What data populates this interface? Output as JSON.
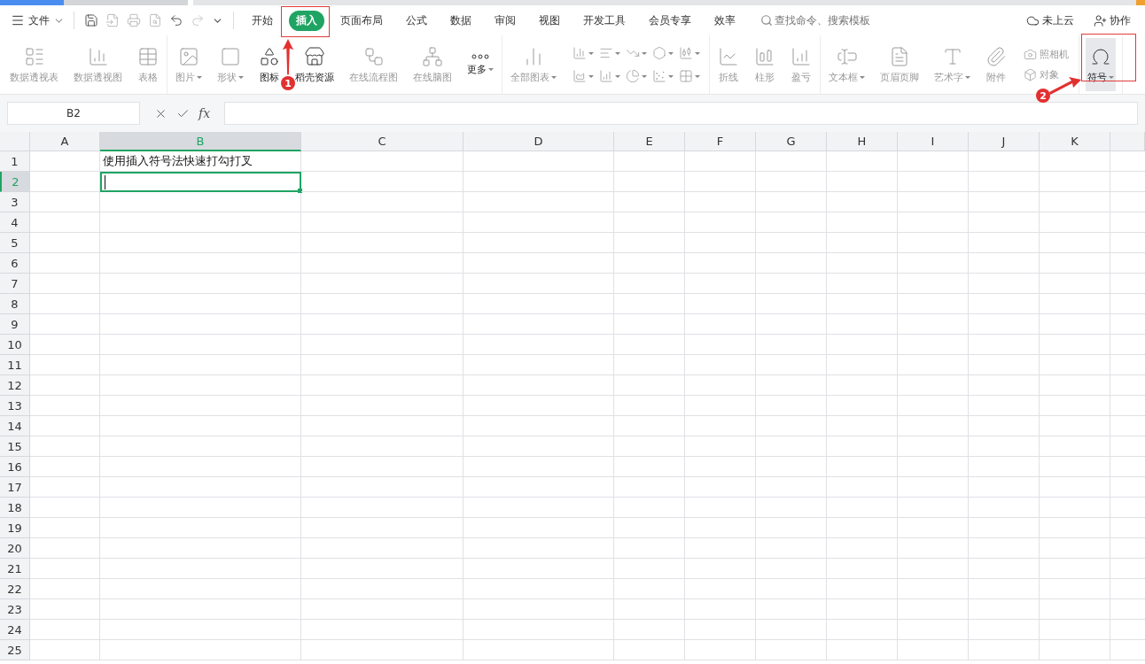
{
  "menu": {
    "file_label": "文件",
    "tabs": [
      {
        "label": "开始",
        "selected": false
      },
      {
        "label": "插入",
        "selected": true
      },
      {
        "label": "页面布局",
        "selected": false
      },
      {
        "label": "公式",
        "selected": false
      },
      {
        "label": "数据",
        "selected": false
      },
      {
        "label": "审阅",
        "selected": false
      },
      {
        "label": "视图",
        "selected": false
      },
      {
        "label": "开发工具",
        "selected": false
      },
      {
        "label": "会员专享",
        "selected": false
      },
      {
        "label": "效率",
        "selected": false
      }
    ],
    "search": {
      "placeholder": "查找命令、搜索模板"
    },
    "cloud": "未上云",
    "collab": "协作"
  },
  "ribbon": {
    "groups": [
      {
        "items": [
          {
            "kind": "large",
            "label": "数据透视表",
            "disabled": true,
            "dropdown": false,
            "highlighted": false
          },
          {
            "kind": "large",
            "label": "数据透视图",
            "disabled": true,
            "dropdown": false,
            "highlighted": false
          },
          {
            "kind": "large",
            "label": "表格",
            "disabled": true,
            "dropdown": false,
            "highlighted": false
          }
        ]
      },
      {
        "items": [
          {
            "kind": "large",
            "label": "图片",
            "disabled": true,
            "dropdown": true,
            "highlighted": false
          },
          {
            "kind": "large",
            "label": "形状",
            "disabled": true,
            "dropdown": true,
            "highlighted": false
          },
          {
            "kind": "large",
            "label": "图标",
            "disabled": false,
            "dropdown": false,
            "highlighted": false
          },
          {
            "kind": "large",
            "label": "稻壳资源",
            "disabled": false,
            "dropdown": false,
            "highlighted": false
          },
          {
            "kind": "large",
            "label": "在线流程图",
            "disabled": true,
            "dropdown": false,
            "highlighted": false
          },
          {
            "kind": "large",
            "label": "在线脑图",
            "disabled": true,
            "dropdown": false,
            "highlighted": false
          },
          {
            "kind": "large",
            "label": "更多",
            "disabled": false,
            "dropdown": true,
            "highlighted": false
          }
        ]
      },
      {
        "items": [
          {
            "kind": "large",
            "label": "全部图表",
            "disabled": true,
            "dropdown": true,
            "highlighted": false
          },
          {
            "kind": "icon",
            "disabled": true,
            "dropdown": true,
            "highlighted": false
          },
          {
            "kind": "icon",
            "disabled": true,
            "dropdown": true,
            "highlighted": false
          },
          {
            "kind": "icon",
            "disabled": true,
            "dropdown": true,
            "highlighted": false
          },
          {
            "kind": "icon",
            "disabled": true,
            "dropdown": true,
            "highlighted": false
          },
          {
            "kind": "icon",
            "disabled": true,
            "dropdown": true,
            "highlighted": false
          },
          {
            "kind": "icon",
            "disabled": true,
            "dropdown": true,
            "highlighted": false
          },
          {
            "kind": "icon",
            "disabled": true,
            "dropdown": true,
            "highlighted": false
          },
          {
            "kind": "icon",
            "disabled": true,
            "dropdown": true,
            "highlighted": false
          },
          {
            "kind": "icon",
            "disabled": true,
            "dropdown": true,
            "highlighted": false
          },
          {
            "kind": "icon",
            "disabled": true,
            "dropdown": true,
            "highlighted": false
          }
        ]
      },
      {
        "items": [
          {
            "kind": "large",
            "label": "折线",
            "disabled": true,
            "dropdown": false,
            "highlighted": false
          },
          {
            "kind": "large",
            "label": "柱形",
            "disabled": true,
            "dropdown": false,
            "highlighted": false
          },
          {
            "kind": "large",
            "label": "盈亏",
            "disabled": true,
            "dropdown": false,
            "highlighted": false
          }
        ]
      },
      {
        "items": [
          {
            "kind": "large",
            "label": "文本框",
            "disabled": true,
            "dropdown": true,
            "highlighted": false
          },
          {
            "kind": "large",
            "label": "页眉页脚",
            "disabled": true,
            "dropdown": false,
            "highlighted": false
          },
          {
            "kind": "large",
            "label": "艺术字",
            "disabled": true,
            "dropdown": true,
            "highlighted": false
          },
          {
            "kind": "large",
            "label": "附件",
            "disabled": true,
            "dropdown": false,
            "highlighted": false
          },
          {
            "kind": "small",
            "label": "照相机",
            "disabled": true,
            "dropdown": false,
            "highlighted": false
          },
          {
            "kind": "small",
            "label": "对象",
            "disabled": true,
            "dropdown": false,
            "highlighted": false
          }
        ]
      },
      {
        "items": [
          {
            "kind": "large",
            "label": "符号",
            "disabled": false,
            "dropdown": true,
            "highlighted": true
          }
        ]
      }
    ]
  },
  "formula_bar": {
    "name_box": "B2",
    "fx": "fx"
  },
  "sheet": {
    "columns": [
      {
        "label": "A",
        "selected": false
      },
      {
        "label": "B",
        "selected": true
      },
      {
        "label": "C",
        "selected": false
      },
      {
        "label": "D",
        "selected": false
      },
      {
        "label": "E",
        "selected": false
      },
      {
        "label": "F",
        "selected": false
      },
      {
        "label": "G",
        "selected": false
      },
      {
        "label": "H",
        "selected": false
      },
      {
        "label": "I",
        "selected": false
      },
      {
        "label": "J",
        "selected": false
      },
      {
        "label": "K",
        "selected": false
      }
    ],
    "rows": [
      {
        "label": "1",
        "selected": false,
        "cells": [
          {},
          {
            "text": "使用插入符号法快速打勾打叉"
          }
        ]
      },
      {
        "label": "2",
        "selected": true
      },
      {
        "label": "3",
        "selected": false
      },
      {
        "label": "4",
        "selected": false
      },
      {
        "label": "5",
        "selected": false
      },
      {
        "label": "6",
        "selected": false
      },
      {
        "label": "7",
        "selected": false
      },
      {
        "label": "8",
        "selected": false
      },
      {
        "label": "9",
        "selected": false
      },
      {
        "label": "10",
        "selected": false
      },
      {
        "label": "11",
        "selected": false
      },
      {
        "label": "12",
        "selected": false
      },
      {
        "label": "13",
        "selected": false
      },
      {
        "label": "14",
        "selected": false
      },
      {
        "label": "15",
        "selected": false
      },
      {
        "label": "16",
        "selected": false
      },
      {
        "label": "17",
        "selected": false
      },
      {
        "label": "18",
        "selected": false
      },
      {
        "label": "19",
        "selected": false
      },
      {
        "label": "20",
        "selected": false
      },
      {
        "label": "21",
        "selected": false
      },
      {
        "label": "22",
        "selected": false
      },
      {
        "label": "23",
        "selected": false
      },
      {
        "label": "24",
        "selected": false
      },
      {
        "label": "25",
        "selected": false
      }
    ]
  },
  "annotations": [
    {
      "number": "1"
    },
    {
      "number": "2"
    }
  ]
}
